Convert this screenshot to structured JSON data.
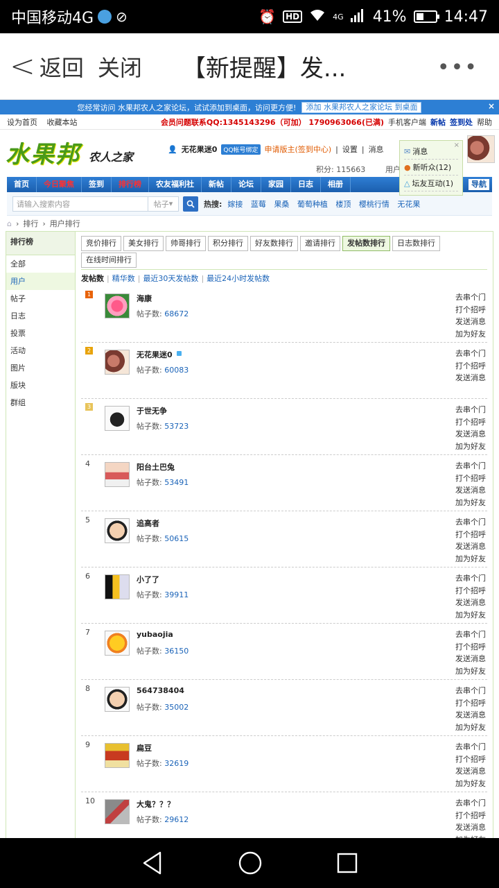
{
  "status_bar": {
    "carrier": "中国移动4G",
    "hd": "HD",
    "network": "4G",
    "battery": "41%",
    "battery_level": 0.41,
    "time": "14:47"
  },
  "app_bar": {
    "back_label": "返回",
    "close_label": "关闭",
    "title": "【新提醒】发...",
    "more_label": "•••"
  },
  "top_strip": {
    "text": "您经常访问 水果邦农人之家论坛，试试添加到桌面，访问更方便!",
    "add_button": "添加 水果邦农人之家论坛 到桌面",
    "close": "×"
  },
  "top_links": {
    "left": [
      "设为首页",
      "收藏本站"
    ],
    "contact": "会员问题联系QQ:1345143296（可加） 1790963066(已满)",
    "right": [
      "手机客户端",
      "新帖",
      "签到处",
      "帮助"
    ]
  },
  "logo": {
    "big": "水果邦",
    "small": "农人之家"
  },
  "user": {
    "name": "无花果迷0",
    "qq_bind": "QQ帐号绑定",
    "apply": "申请版主(签到中心)",
    "settings": "设置",
    "messages": "消息",
    "score_label": "积分: 115663",
    "user_group": "用户"
  },
  "popup": {
    "items": [
      "消息",
      "新听众(12)",
      "坛友互动(1)"
    ],
    "close": "×"
  },
  "nav": {
    "items": [
      "首页",
      "今日聚焦",
      "签到",
      "排行榜",
      "农友福利社",
      "新帖",
      "论坛",
      "家园",
      "日志",
      "相册"
    ],
    "right": "导航"
  },
  "search": {
    "placeholder": "请输入搜索内容",
    "select": "帖子",
    "hot_label": "热搜:",
    "hot_links": [
      "嫁接",
      "蓝莓",
      "果桑",
      "葡萄种植",
      "楼顶",
      "樱桃行情",
      "无花果"
    ]
  },
  "breadcrumb": [
    "排行",
    "用户排行"
  ],
  "sidebar": {
    "title": "排行榜",
    "items": [
      "全部",
      "用户",
      "帖子",
      "日志",
      "投票",
      "活动",
      "图片",
      "版块",
      "群组"
    ]
  },
  "tabs": [
    "竞价排行",
    "美女排行",
    "帅哥排行",
    "积分排行",
    "好友数排行",
    "邀请排行",
    "发帖数排行",
    "日志数排行",
    "在线时间排行"
  ],
  "subtabs": [
    "发帖数",
    "精华数",
    "最近30天发帖数",
    "最近24小时发帖数"
  ],
  "posts_label": "帖子数:",
  "actions": [
    "去串个门",
    "打个招呼",
    "发送消息",
    "加为好友"
  ],
  "ranking": [
    {
      "rank": "1",
      "name": "海康",
      "posts": "68672",
      "actions": [
        "去串个门",
        "打个招呼",
        "发送消息",
        "加为好友"
      ]
    },
    {
      "rank": "2",
      "name": "无花果迷0",
      "posts": "60083",
      "actions": [
        "去串个门",
        "打个招呼",
        "发送消息"
      ]
    },
    {
      "rank": "3",
      "name": "于世无争",
      "posts": "53723",
      "actions": [
        "去串个门",
        "打个招呼",
        "发送消息",
        "加为好友"
      ]
    },
    {
      "rank": "4",
      "name": "阳台土巴兔",
      "posts": "53491",
      "actions": [
        "去串个门",
        "打个招呼",
        "发送消息",
        "加为好友"
      ]
    },
    {
      "rank": "5",
      "name": "追高者",
      "posts": "50615",
      "actions": [
        "去串个门",
        "打个招呼",
        "发送消息",
        "加为好友"
      ]
    },
    {
      "rank": "6",
      "name": "小了了",
      "posts": "39911",
      "actions": [
        "去串个门",
        "打个招呼",
        "发送消息",
        "加为好友"
      ]
    },
    {
      "rank": "7",
      "name": "yubaojia",
      "posts": "36150",
      "actions": [
        "去串个门",
        "打个招呼",
        "发送消息",
        "加为好友"
      ]
    },
    {
      "rank": "8",
      "name": "564738404",
      "posts": "35002",
      "actions": [
        "去串个门",
        "打个招呼",
        "发送消息",
        "加为好友"
      ]
    },
    {
      "rank": "9",
      "name": "扁豆",
      "posts": "32619",
      "actions": [
        "去串个门",
        "打个招呼",
        "发送消息",
        "加为好友"
      ]
    },
    {
      "rank": "10",
      "name": "大鬼？？？",
      "posts": "29612",
      "actions": [
        "去串个门",
        "打个招呼",
        "发送消息",
        "加为好友"
      ]
    }
  ]
}
